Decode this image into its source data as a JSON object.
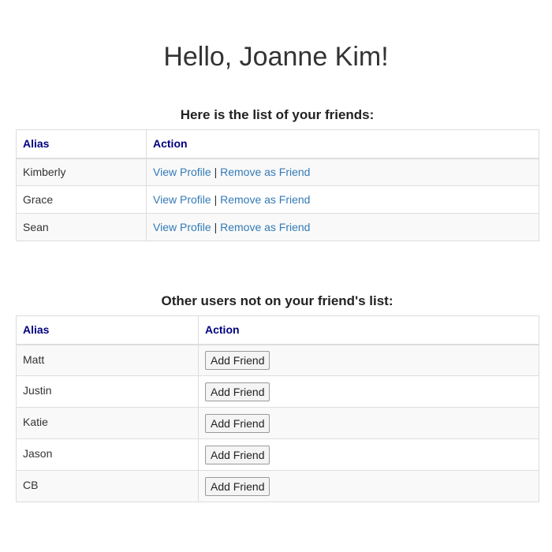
{
  "greeting": "Hello, Joanne Kim!",
  "friends": {
    "heading": "Here is the list of your friends:",
    "columns": {
      "alias": "Alias",
      "action": "Action"
    },
    "view_label": "View Profile",
    "separator": "|",
    "remove_label": "Remove as Friend",
    "rows": [
      {
        "alias": "Kimberly"
      },
      {
        "alias": "Grace"
      },
      {
        "alias": "Sean"
      }
    ]
  },
  "others": {
    "heading": "Other users not on your friend's list:",
    "columns": {
      "alias": "Alias",
      "action": "Action"
    },
    "add_label": "Add Friend",
    "rows": [
      {
        "alias": "Matt"
      },
      {
        "alias": "Justin"
      },
      {
        "alias": "Katie"
      },
      {
        "alias": "Jason"
      },
      {
        "alias": "CB"
      }
    ]
  },
  "colors": {
    "header_text": "#000080",
    "link": "#337ab7",
    "border": "#dddddd",
    "stripe": "#f9f9f9"
  }
}
